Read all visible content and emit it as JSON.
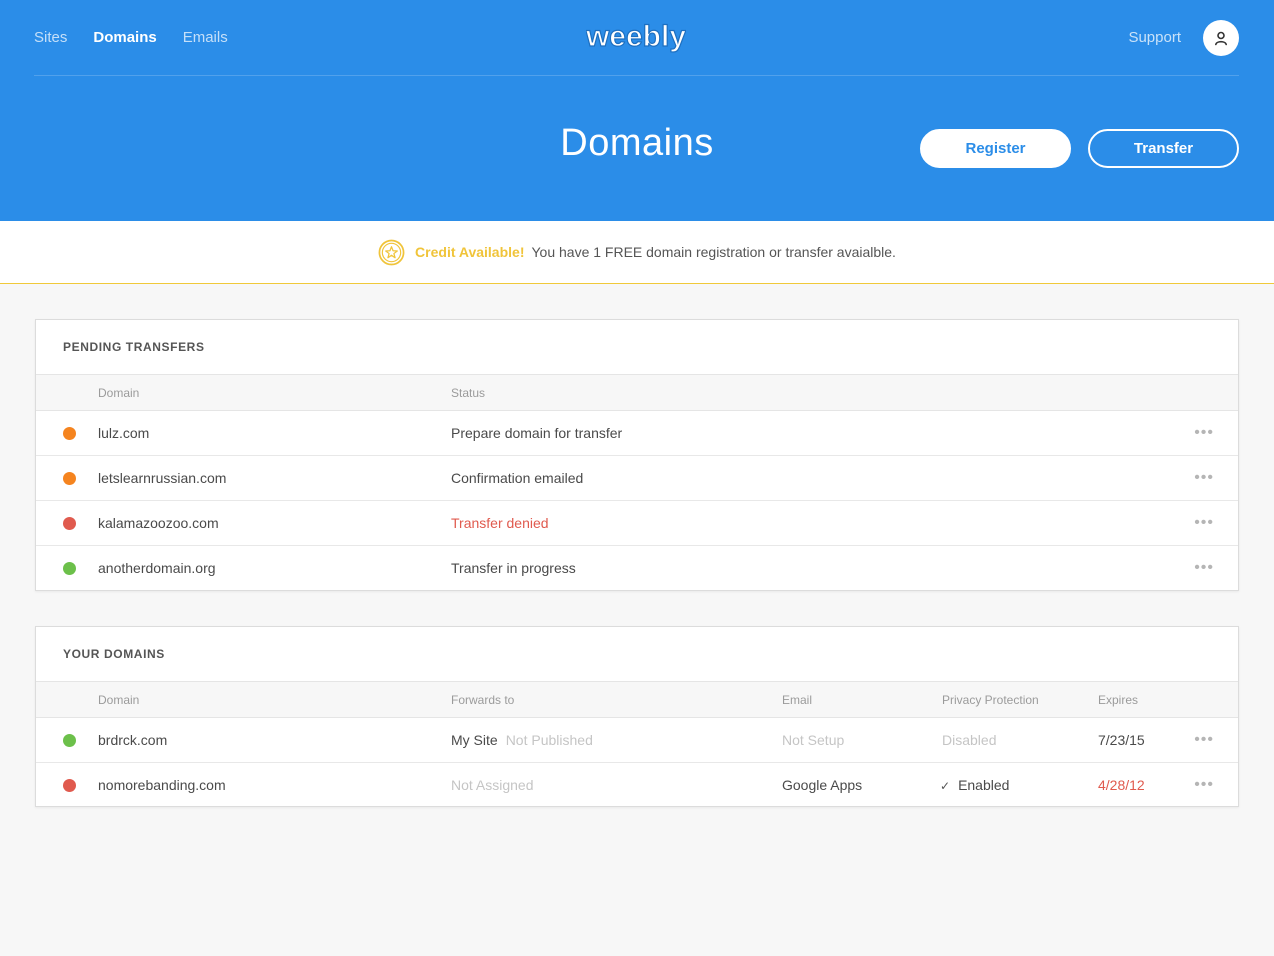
{
  "nav": {
    "sites": "Sites",
    "domains": "Domains",
    "emails": "Emails",
    "logo": "weebly",
    "support": "Support"
  },
  "hero": {
    "title": "Domains",
    "register": "Register",
    "transfer": "Transfer"
  },
  "credit": {
    "label": "Credit Available!",
    "text": "You have 1 FREE domain registration or transfer avaialble."
  },
  "pending": {
    "title": "PENDING TRANSFERS",
    "headers": {
      "domain": "Domain",
      "status": "Status"
    },
    "rows": [
      {
        "domain": "lulz.com",
        "status": "Prepare domain for transfer",
        "dot": "#f5841f",
        "status_color": "normal"
      },
      {
        "domain": "letslearnrussian.com",
        "status": "Confirmation emailed",
        "dot": "#f5841f",
        "status_color": "normal"
      },
      {
        "domain": "kalamazoozoo.com",
        "status": "Transfer denied",
        "dot": "#e05a4e",
        "status_color": "red"
      },
      {
        "domain": "anotherdomain.org",
        "status": "Transfer in progress",
        "dot": "#6cc04a",
        "status_color": "normal"
      }
    ]
  },
  "domains": {
    "title": "YOUR DOMAINS",
    "headers": {
      "domain": "Domain",
      "forwards": "Forwards to",
      "email": "Email",
      "privacy": "Privacy Protection",
      "expires": "Expires"
    },
    "rows": [
      {
        "domain": "brdrck.com",
        "forwards": "My Site",
        "forwards_sub": "Not Published",
        "email": "Not Setup",
        "privacy": "Disabled",
        "expires": "7/23/15",
        "dot": "#6cc04a"
      },
      {
        "domain": "nomorebanding.com",
        "forwards": "Not Assigned",
        "forwards_sub": "",
        "email": "Google Apps",
        "privacy": "Enabled",
        "expires": "4/28/12",
        "dot": "#e05a4e"
      }
    ]
  },
  "colors": {
    "brand": "#2b8de8",
    "warning": "#f0c43a",
    "orange": "#f5841f",
    "red": "#e05a4e",
    "green": "#6cc04a"
  },
  "icons": {
    "avatar": "user-icon",
    "credit": "star-coin-icon",
    "more": "more-dots-icon",
    "check": "check-icon"
  },
  "more_glyph": "•••",
  "check_glyph": "✓"
}
